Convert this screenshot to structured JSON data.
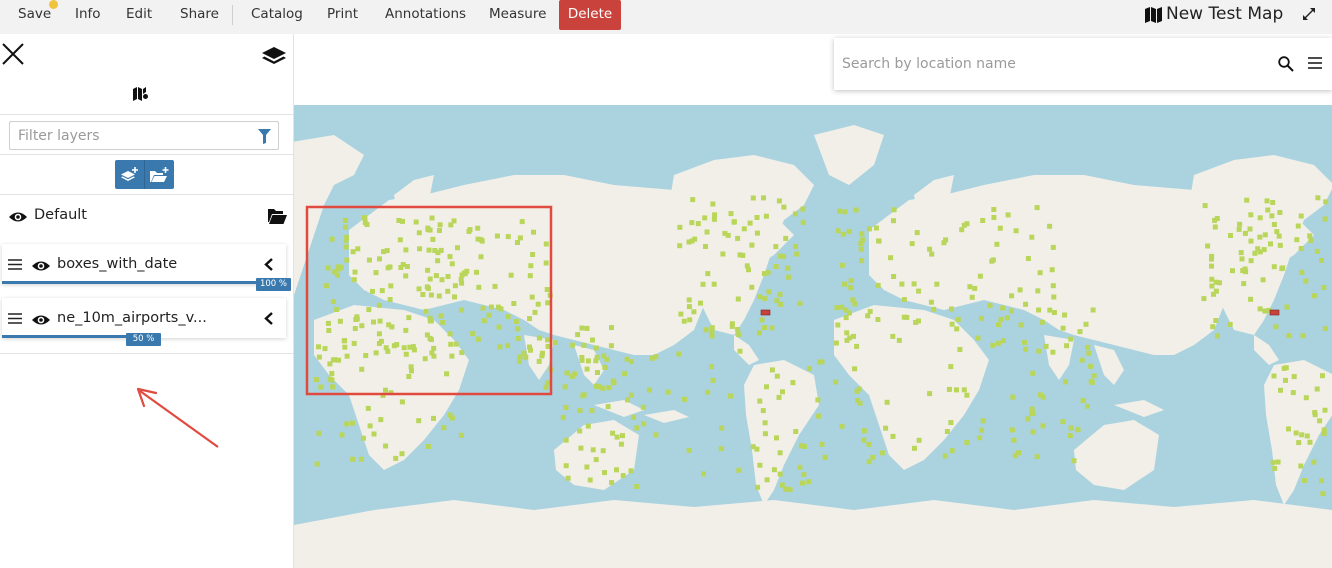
{
  "toolbar": {
    "items": [
      "Save",
      "Info",
      "Edit",
      "Share",
      "Catalog",
      "Print",
      "Annotations",
      "Measure"
    ],
    "delete_label": "Delete",
    "map_title": "New Test Map",
    "delete_color": "#c9423b",
    "save_indicator_color": "#f0c33c",
    "icons": [
      "map-icon",
      "expand-icon"
    ]
  },
  "sidebar": {
    "filter_placeholder": "Filter layers",
    "default_group": {
      "label": "Default",
      "visible": true
    },
    "layers": [
      {
        "label": "boxes_with_date",
        "opacity_label": "100 %",
        "opacity": 1.0,
        "visible": true
      },
      {
        "label": "ne_10m_airports_v...",
        "opacity_label": "50 %",
        "opacity": 0.5,
        "visible": true
      }
    ],
    "accent_color": "#3a79ad",
    "icons": [
      "close-icon",
      "layers-icon",
      "catalog-icon",
      "filter-icon",
      "add-layer-icon",
      "add-group-icon",
      "folder-open-icon",
      "drag-handle-icon",
      "eye-icon",
      "chevron-left-icon"
    ]
  },
  "map": {
    "search_placeholder": "Search by location name",
    "ocean_color": "#aad3df",
    "land_color": "#f2efe9",
    "airport_marker_color": "#b9d65a",
    "highlight_box_color": "#e04a3f",
    "icons": [
      "search-icon",
      "menu-icon"
    ]
  }
}
